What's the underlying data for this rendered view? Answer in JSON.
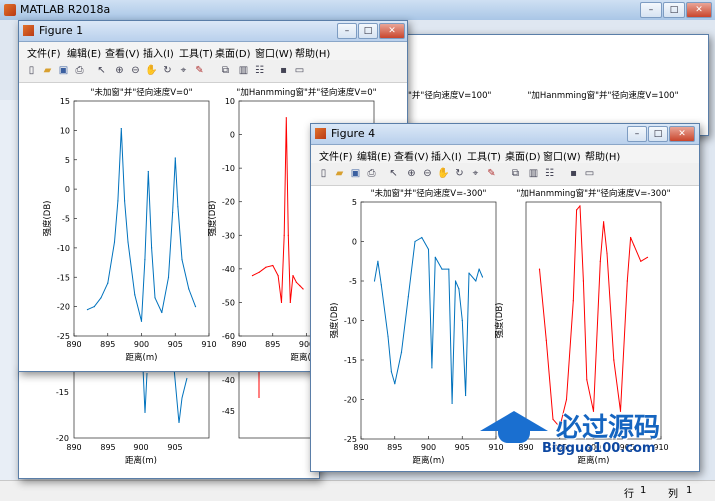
{
  "main_window": {
    "title": "MATLAB R2018a",
    "status_row_label": "行",
    "status_row_value": "1",
    "status_col_label": "列",
    "status_col_value": "1"
  },
  "menu_items": [
    "文件(F)",
    "编辑(E)",
    "查看(V)",
    "插入(I)",
    "工具(T)",
    "桌面(D)",
    "窗口(W)",
    "帮助(H)"
  ],
  "watermark": {
    "text": "必过源码",
    "url": "Bigguo100.com"
  },
  "figure1": {
    "title": "Figure 1",
    "charts": [
      {
        "type": "line",
        "title": "\"未加窗\"并\"径向速度V=0\"",
        "xlabel": "距离(m)",
        "ylabel": "强度(DB)",
        "xlim": [
          890,
          910
        ],
        "ylim": [
          -25,
          15
        ],
        "xticks": [
          "890",
          "895",
          "900",
          "905",
          "910"
        ],
        "yticks": [
          "15",
          "10",
          "5",
          "0",
          "-5",
          "-10",
          "-15",
          "-20",
          "-25"
        ],
        "color": "#0072BD",
        "x": [
          892.0,
          893.0,
          894.0,
          895.0,
          896.0,
          896.5,
          897.0,
          897.5,
          898.0,
          899.0,
          900.0,
          900.5,
          901.0,
          901.5,
          902.0,
          903.0,
          904.0,
          904.6,
          905.0,
          905.4,
          906.0,
          907.0,
          908.0
        ],
        "y": [
          -20.5,
          -20.0,
          -18.5,
          -16.0,
          -9.0,
          -2.0,
          10.3,
          -2.0,
          -9.0,
          -18.0,
          -22.5,
          -12.0,
          3.0,
          -10.0,
          -18.5,
          -21.0,
          -15.0,
          -4.0,
          5.3,
          -3.0,
          -12.0,
          -17.0,
          -20.0
        ]
      },
      {
        "type": "line",
        "title": "\"加Hanmming窗\"并\"径向速度V=0\"",
        "xlabel": "距离(m)",
        "ylabel": "强度(DB)",
        "xlim": [
          890,
          910
        ],
        "ylim": [
          -60,
          10
        ],
        "xticks": [
          "890",
          "895",
          "900",
          "905",
          "910"
        ],
        "yticks": [
          "10",
          "0",
          "-10",
          "-20",
          "-30",
          "-40",
          "-50",
          "-60"
        ],
        "color": "#FF0000",
        "x": [
          892.0,
          893.0,
          894.0,
          895.0,
          895.8,
          896.3,
          896.7,
          897.0,
          897.3,
          897.6,
          898.0,
          898.5,
          899.0,
          899.5
        ],
        "y": [
          -42.0,
          -41.0,
          -39.5,
          -39.0,
          -42.0,
          -50.0,
          -30.0,
          5.0,
          -30.0,
          -50.0,
          -42.0,
          -44.0,
          -45.0,
          -46.0
        ]
      }
    ]
  },
  "figure_bg": {
    "title1": "\"未加窗\"并\"径向速度V=100\"",
    "title2": "\"加Hanmming窗\"并\"径向速度V=100\"",
    "xlabel": "距离(m)",
    "left_yticks": [
      "-15",
      "-20"
    ],
    "right_yticks": [
      "-40",
      "-45"
    ],
    "xticks": [
      "890",
      "895",
      "900",
      "905"
    ]
  },
  "figure4": {
    "title": "Figure 4",
    "charts": [
      {
        "type": "line",
        "title": "\"未加窗\"并\"径向速度V=-300\"",
        "xlabel": "距离(m)",
        "ylabel": "强度(DB)",
        "xlim": [
          890,
          910
        ],
        "ylim": [
          -25,
          5
        ],
        "xticks": [
          "890",
          "895",
          "900",
          "905",
          "910"
        ],
        "yticks": [
          "5",
          "0",
          "-5",
          "-10",
          "-15",
          "-20",
          "-25"
        ],
        "color": "#0072BD",
        "x": [
          892.0,
          892.5,
          893.0,
          894.0,
          894.5,
          895.0,
          896.0,
          897.0,
          898.0,
          899.0,
          900.0,
          900.5,
          901.0,
          902.0,
          903.0,
          903.5,
          904.0,
          904.5,
          905.0,
          905.5,
          906.0,
          907.0,
          907.5,
          908.0
        ],
        "y": [
          -5.0,
          -2.5,
          -5.5,
          -12.0,
          -16.5,
          -18.0,
          -14.0,
          -7.0,
          0.0,
          0.5,
          -1.0,
          -16.0,
          -2.0,
          -3.5,
          -3.5,
          -20.5,
          -5.0,
          -6.0,
          -10.0,
          -19.5,
          -4.0,
          -5.0,
          -3.5,
          -4.5
        ]
      },
      {
        "type": "line",
        "title": "\"加Hanmming窗\"并\"径向速度V=-300\"",
        "xlabel": "距离(m)",
        "ylabel": "强度(DB)",
        "xlim": [
          890,
          910
        ],
        "ylim": [
          -75,
          -15
        ],
        "xticks": [
          "890",
          "895",
          "900",
          "905",
          "910"
        ],
        "yticks": [],
        "color": "#FF0000",
        "x": [
          892.0,
          893.0,
          894.0,
          895.0,
          896.0,
          897.0,
          897.5,
          898.0,
          898.5,
          899.0,
          900.0,
          901.0,
          901.5,
          902.0,
          903.0,
          904.0,
          905.0,
          905.5,
          906.0,
          907.0,
          908.0
        ],
        "y": [
          -32.0,
          -50.0,
          -70.0,
          -72.0,
          -65.0,
          -40.0,
          -17.0,
          -16.0,
          -35.0,
          -60.0,
          -68.0,
          -30.0,
          -20.0,
          -28.0,
          -55.0,
          -68.0,
          -35.0,
          -24.0,
          -26.0,
          -30.0,
          -29.0
        ]
      }
    ]
  }
}
